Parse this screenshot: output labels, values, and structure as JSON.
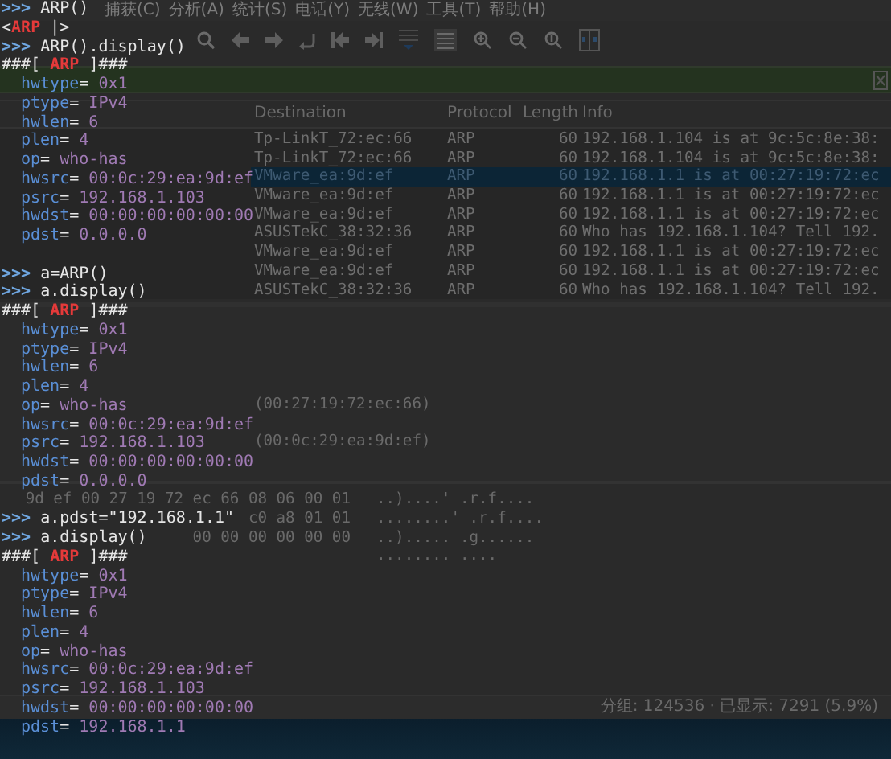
{
  "wireshark": {
    "menu": [
      "捕获(C)",
      "分析(A)",
      "统计(S)",
      "电话(Y)",
      "无线(W)",
      "工具(T)",
      "帮助(H)"
    ],
    "packet_list": {
      "columns": [
        "Destination",
        "Protocol",
        "Length",
        "Info"
      ],
      "rows": [
        {
          "destination": "Tp-LinkT_72:ec:66",
          "protocol": "ARP",
          "length": "60",
          "info": "192.168.1.104 is at 9c:5c:8e:38:",
          "selected": false
        },
        {
          "destination": "Tp-LinkT_72:ec:66",
          "protocol": "ARP",
          "length": "60",
          "info": "192.168.1.104 is at 9c:5c:8e:38:",
          "selected": false
        },
        {
          "destination": "VMware_ea:9d:ef",
          "protocol": "ARP",
          "length": "60",
          "info": "192.168.1.1 is at 00:27:19:72:ec",
          "selected": true
        },
        {
          "destination": "VMware_ea:9d:ef",
          "protocol": "ARP",
          "length": "60",
          "info": "192.168.1.1 is at 00:27:19:72:ec",
          "selected": false
        },
        {
          "destination": "VMware_ea:9d:ef",
          "protocol": "ARP",
          "length": "60",
          "info": "192.168.1.1 is at 00:27:19:72:ec",
          "selected": false
        },
        {
          "destination": "ASUSTekC_38:32:36",
          "protocol": "ARP",
          "length": "60",
          "info": "Who has 192.168.1.104? Tell 192.",
          "selected": false
        },
        {
          "destination": "VMware_ea:9d:ef",
          "protocol": "ARP",
          "length": "60",
          "info": "192.168.1.1 is at 00:27:19:72:ec",
          "selected": false
        },
        {
          "destination": "VMware_ea:9d:ef",
          "protocol": "ARP",
          "length": "60",
          "info": "192.168.1.1 is at 00:27:19:72:ec",
          "selected": false
        },
        {
          "destination": "ASUSTekC_38:32:36",
          "protocol": "ARP",
          "length": "60",
          "info": "Who has 192.168.1.104? Tell 192.",
          "selected": false
        }
      ]
    },
    "details": {
      "lines": [
        {
          "kind": "blank"
        },
        {
          "kind": "blank"
        },
        {
          "kind": "blank"
        },
        {
          "kind": "blank"
        },
        {
          "kind": "text",
          "text": "(00:27:19:72:ec:66)"
        },
        {
          "kind": "blank"
        },
        {
          "kind": "text",
          "text": "(00:0c:29:ea:9d:ef)"
        }
      ]
    },
    "bytes": {
      "lines": [
        {
          "hex": "9d ef 00 27  19 72 ec 66 08 06 00 01",
          "ascii": "..)....' .r.f...."
        },
        {
          "hex": "c0 a8 01 01",
          "ascii": "........' .r.f...."
        },
        {
          "hex": "00 00 00 00 00 00",
          "ascii": "..)..... .g......"
        },
        {
          "ascii": "........ ...."
        }
      ]
    },
    "status_bar": {
      "text": "分组: 124536 · 已显示: 7291 (5.9%)"
    }
  },
  "terminal": {
    "lines": [
      {
        "kind": "prompt",
        "prompt": ">>>",
        "command": "ARP()"
      },
      {
        "kind": "repr",
        "open": "<",
        "name": "ARP",
        "close": "|>"
      },
      {
        "kind": "prompt",
        "prompt": ">>>",
        "command": "ARP().display()"
      },
      {
        "kind": "header",
        "left": "###[",
        "name": "ARP",
        "right": "]###"
      },
      {
        "kind": "field",
        "name": "hwtype",
        "sep": "=",
        "value": "0x1"
      },
      {
        "kind": "field",
        "name": "ptype",
        "sep": "=",
        "value": "IPv4"
      },
      {
        "kind": "field",
        "name": "hwlen",
        "sep": "=",
        "value": "6"
      },
      {
        "kind": "field",
        "name": "plen",
        "sep": "=",
        "value": "4"
      },
      {
        "kind": "field",
        "name": "op",
        "sep": "=",
        "value": "who-has"
      },
      {
        "kind": "field",
        "name": "hwsrc",
        "sep": "=",
        "value": "00:0c:29:ea:9d:ef"
      },
      {
        "kind": "field",
        "name": "psrc",
        "sep": "=",
        "value": "192.168.1.103"
      },
      {
        "kind": "field",
        "name": "hwdst",
        "sep": "=",
        "value": "00:00:00:00:00:00"
      },
      {
        "kind": "field",
        "name": "pdst",
        "sep": "=",
        "value": "0.0.0.0"
      },
      {
        "kind": "blank"
      },
      {
        "kind": "prompt",
        "prompt": ">>>",
        "command": "a=ARP()"
      },
      {
        "kind": "prompt",
        "prompt": ">>>",
        "command": "a.display()"
      },
      {
        "kind": "header",
        "left": "###[",
        "name": "ARP",
        "right": "]###"
      },
      {
        "kind": "field",
        "name": "hwtype",
        "sep": "=",
        "value": "0x1"
      },
      {
        "kind": "field",
        "name": "ptype",
        "sep": "=",
        "value": "IPv4"
      },
      {
        "kind": "field",
        "name": "hwlen",
        "sep": "=",
        "value": "6"
      },
      {
        "kind": "field",
        "name": "plen",
        "sep": "=",
        "value": "4"
      },
      {
        "kind": "field",
        "name": "op",
        "sep": "=",
        "value": "who-has"
      },
      {
        "kind": "field",
        "name": "hwsrc",
        "sep": "=",
        "value": "00:0c:29:ea:9d:ef"
      },
      {
        "kind": "field",
        "name": "psrc",
        "sep": "=",
        "value": "192.168.1.103"
      },
      {
        "kind": "field",
        "name": "hwdst",
        "sep": "=",
        "value": "00:00:00:00:00:00"
      },
      {
        "kind": "field",
        "name": "pdst",
        "sep": "=",
        "value": "0.0.0.0"
      },
      {
        "kind": "blank"
      },
      {
        "kind": "prompt",
        "prompt": ">>>",
        "command": "a.pdst=\"192.168.1.1\""
      },
      {
        "kind": "prompt",
        "prompt": ">>>",
        "command": "a.display()"
      },
      {
        "kind": "header",
        "left": "###[",
        "name": "ARP",
        "right": "]###"
      },
      {
        "kind": "field",
        "name": "hwtype",
        "sep": "=",
        "value": "0x1"
      },
      {
        "kind": "field",
        "name": "ptype",
        "sep": "=",
        "value": "IPv4"
      },
      {
        "kind": "field",
        "name": "hwlen",
        "sep": "=",
        "value": "6"
      },
      {
        "kind": "field",
        "name": "plen",
        "sep": "=",
        "value": "4"
      },
      {
        "kind": "field",
        "name": "op",
        "sep": "=",
        "value": "who-has"
      },
      {
        "kind": "field",
        "name": "hwsrc",
        "sep": "=",
        "value": "00:0c:29:ea:9d:ef"
      },
      {
        "kind": "field",
        "name": "psrc",
        "sep": "=",
        "value": "192.168.1.103"
      },
      {
        "kind": "field",
        "name": "hwdst",
        "sep": "=",
        "value": "00:00:00:00:00:00"
      },
      {
        "kind": "field",
        "name": "pdst",
        "sep": "=",
        "value": "192.168.1.1"
      }
    ]
  }
}
